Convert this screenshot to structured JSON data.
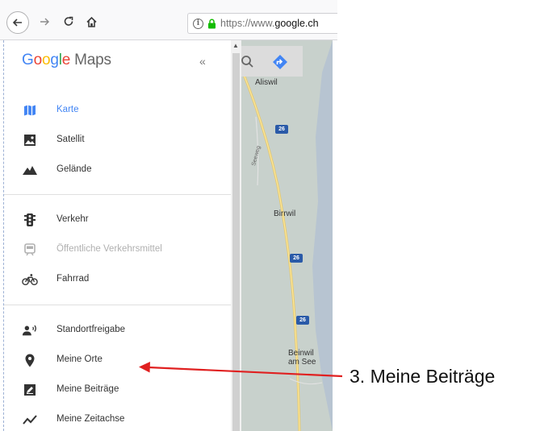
{
  "browser": {
    "url_prefix": "https://www.",
    "url_domain": "google.ch"
  },
  "panel": {
    "logo": {
      "G": "G",
      "o1": "o",
      "o2": "o",
      "g": "g",
      "l": "l",
      "e": "e",
      "maps": "Maps"
    },
    "collapse_label": "«",
    "groups": [
      [
        {
          "label": "Karte",
          "icon": "map-icon",
          "state": "active"
        },
        {
          "label": "Satellit",
          "icon": "satellite-image-icon",
          "state": "normal"
        },
        {
          "label": "Gelände",
          "icon": "terrain-icon",
          "state": "normal"
        }
      ],
      [
        {
          "label": "Verkehr",
          "icon": "traffic-light-icon",
          "state": "normal"
        },
        {
          "label": "Öffentliche Verkehrsmittel",
          "icon": "train-icon",
          "state": "disabled"
        },
        {
          "label": "Fahrrad",
          "icon": "bicycle-icon",
          "state": "normal"
        }
      ],
      [
        {
          "label": "Standortfreigabe",
          "icon": "location-sharing-icon",
          "state": "normal"
        },
        {
          "label": "Meine Orte",
          "icon": "place-pin-icon",
          "state": "normal"
        },
        {
          "label": "Meine Beiträge",
          "icon": "contributions-icon",
          "state": "normal"
        },
        {
          "label": "Meine Zeitachse",
          "icon": "timeline-icon",
          "state": "normal"
        }
      ]
    ]
  },
  "map": {
    "towns": [
      "Aliswil",
      "Birrwil",
      "Beinwil",
      "am See"
    ],
    "route_shields": [
      "26",
      "26",
      "26"
    ],
    "street_label": "Seeweg"
  },
  "annotation": {
    "text": "3. Meine Beiträge",
    "arrow_color": "#e02020"
  },
  "colors": {
    "google_blue": "#4285f4",
    "google_red": "#ea4335",
    "google_yellow": "#fbbc05",
    "google_green": "#34a853"
  }
}
